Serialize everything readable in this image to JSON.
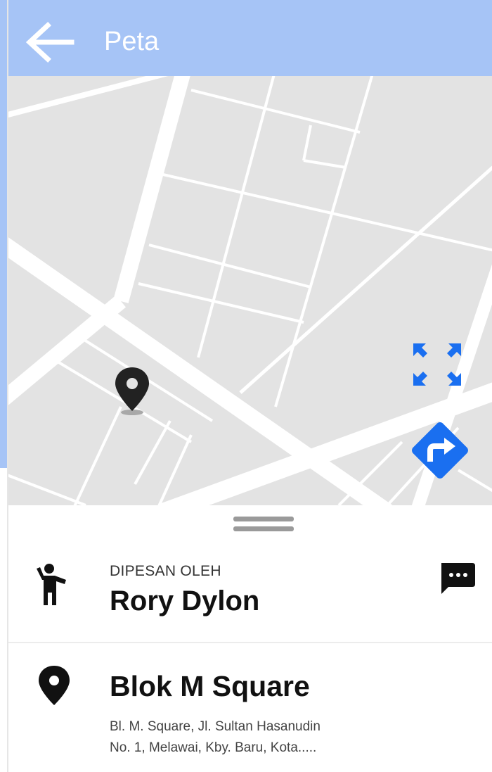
{
  "header": {
    "title": "Peta",
    "back_icon": "arrow-left-icon",
    "background_color": "#a6c4f6"
  },
  "map": {
    "pin_icon": "map-pin-icon",
    "expand_icon": "expand-arrows-icon",
    "directions_icon": "turn-right-diamond-icon",
    "accent_color": "#1a6ff0"
  },
  "sheet": {
    "handle_icon": "drag-handle-icon",
    "booker": {
      "icon": "person-waving-icon",
      "label": "DIPESAN OLEH",
      "name": "Rory Dylon",
      "chat_icon": "chat-bubble-icon"
    },
    "place": {
      "icon": "location-pin-icon",
      "name": "Blok M Square",
      "address_line1": "Bl. M. Square, Jl. Sultan Hasanudin",
      "address_line2": "No. 1, Melawai, Kby. Baru, Kota....."
    }
  }
}
